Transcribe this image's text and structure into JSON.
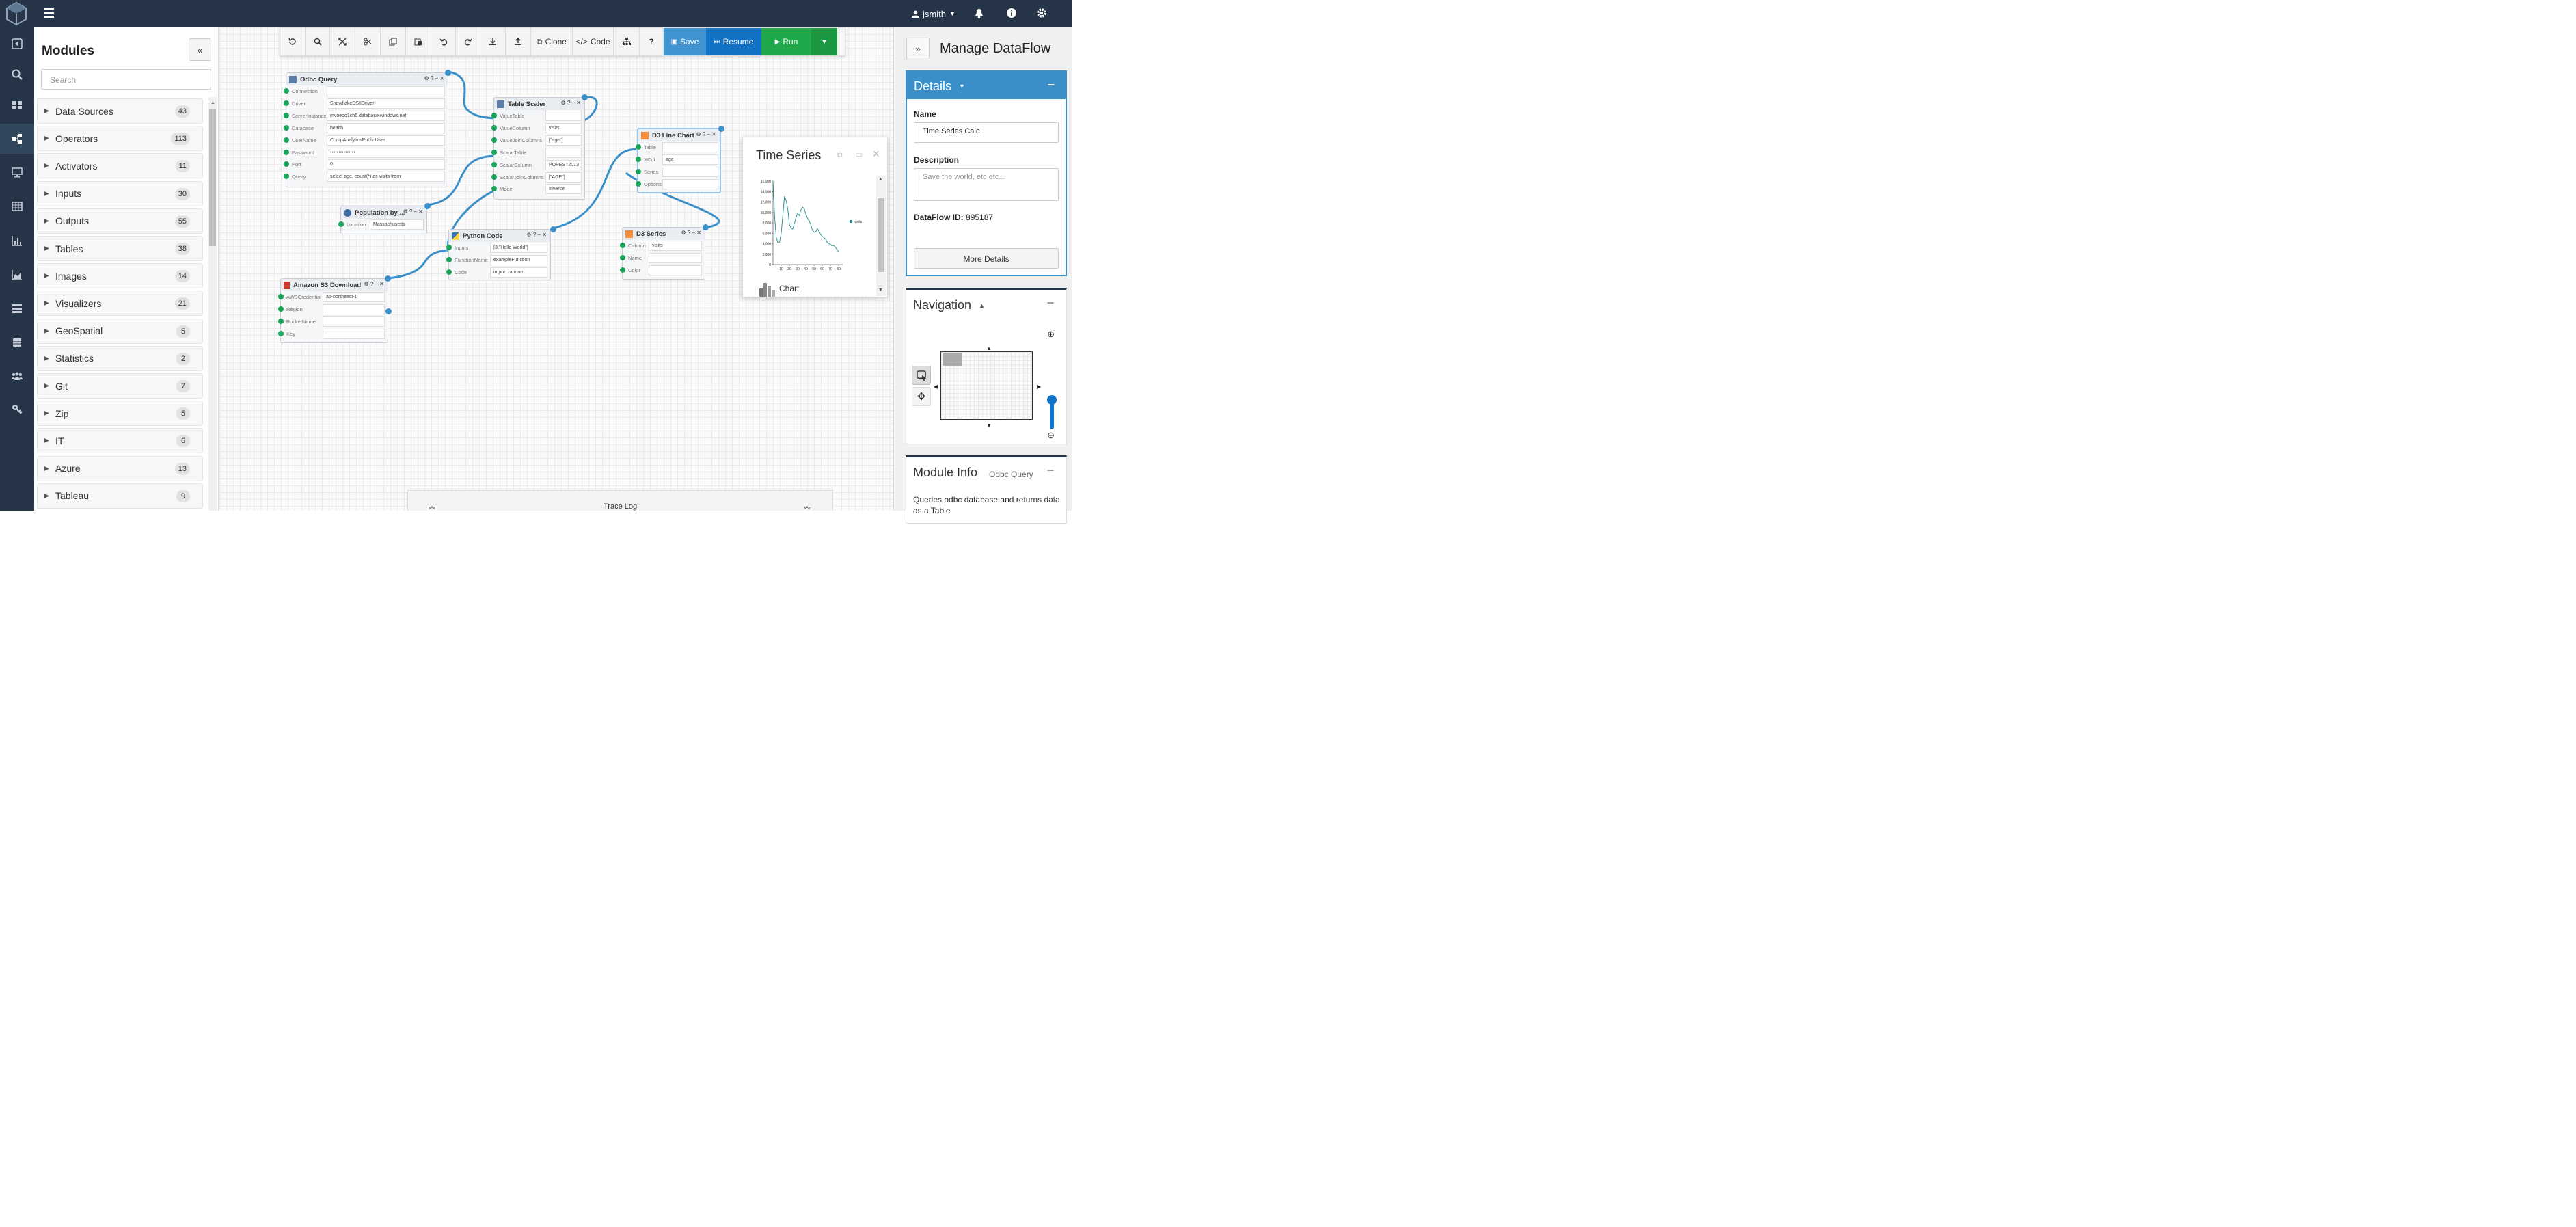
{
  "topbar": {
    "user": "jsmith"
  },
  "modules": {
    "title": "Modules",
    "search_placeholder": "Search",
    "items": [
      {
        "label": "Data Sources",
        "count": "43"
      },
      {
        "label": "Operators",
        "count": "113"
      },
      {
        "label": "Activators",
        "count": "11"
      },
      {
        "label": "Inputs",
        "count": "30"
      },
      {
        "label": "Outputs",
        "count": "55"
      },
      {
        "label": "Tables",
        "count": "38"
      },
      {
        "label": "Images",
        "count": "14"
      },
      {
        "label": "Visualizers",
        "count": "21"
      },
      {
        "label": "GeoSpatial",
        "count": "5"
      },
      {
        "label": "Statistics",
        "count": "2"
      },
      {
        "label": "Git",
        "count": "7"
      },
      {
        "label": "Zip",
        "count": "5"
      },
      {
        "label": "IT",
        "count": "6"
      },
      {
        "label": "Azure",
        "count": "13"
      },
      {
        "label": "Tableau",
        "count": "9"
      }
    ]
  },
  "toolbar": {
    "clone": "Clone",
    "code": "Code",
    "help": "?",
    "save": "Save",
    "resume": "Resume",
    "run": "Run"
  },
  "nodes": {
    "odbc": {
      "title": "Odbc Query",
      "params": [
        {
          "label": "Connection",
          "value": ""
        },
        {
          "label": "Driver",
          "value": "SnowflakeDSIIDriver"
        },
        {
          "label": "ServerInstance",
          "value": "mvoeqq1ch5.database.windows.net"
        },
        {
          "label": "Database",
          "value": "health"
        },
        {
          "label": "UserName",
          "value": "CompAnalyticsPublicUser"
        },
        {
          "label": "Password",
          "value": "•••••••••••••••"
        },
        {
          "label": "Port",
          "value": "0"
        },
        {
          "label": "Query",
          "value": "select age, count(*) as visits from"
        }
      ]
    },
    "scaler": {
      "title": "Table Scaler",
      "params": [
        {
          "label": "ValueTable",
          "value": ""
        },
        {
          "label": "ValueColumn",
          "value": "visits"
        },
        {
          "label": "ValueJoinColumns",
          "value": "[\"age\"]"
        },
        {
          "label": "ScalarTable",
          "value": ""
        },
        {
          "label": "ScalarColumn",
          "value": "POPEST2013_"
        },
        {
          "label": "ScalarJoinColumns",
          "value": "[\"AGE\"]"
        },
        {
          "label": "Mode",
          "value": "Inverse"
        }
      ]
    },
    "population": {
      "title": "Population by ...",
      "params": [
        {
          "label": "Location",
          "value": "Massachusetts"
        }
      ]
    },
    "python": {
      "title": "Python Code",
      "params": [
        {
          "label": "Inputs",
          "value": "[3,\"Hello World\"]"
        },
        {
          "label": "FunctionName",
          "value": "exampleFunction"
        },
        {
          "label": "Code",
          "value": "import random"
        }
      ]
    },
    "s3": {
      "title": "Amazon S3 Download",
      "params": [
        {
          "label": "AWSCredential",
          "value": "ap-northeast-1"
        },
        {
          "label": "Region",
          "value": ""
        },
        {
          "label": "BucketName",
          "value": ""
        },
        {
          "label": "Key",
          "value": ""
        }
      ]
    },
    "d3line": {
      "title": "D3 Line Chart",
      "params": [
        {
          "label": "Table",
          "value": ""
        },
        {
          "label": "XCol",
          "value": "age"
        },
        {
          "label": "Series",
          "value": ""
        },
        {
          "label": "Options",
          "value": ""
        }
      ]
    },
    "d3series": {
      "title": "D3 Series",
      "params": [
        {
          "label": "Column",
          "value": "visits"
        },
        {
          "label": "Name",
          "value": ""
        },
        {
          "label": "Color",
          "value": ""
        }
      ]
    }
  },
  "timeseries": {
    "title": "Time Series",
    "chart_label": "Chart",
    "chart_data": {
      "type": "line",
      "series": [
        {
          "name": "visits",
          "x": [
            0,
            2,
            4,
            6,
            8,
            10,
            12,
            14,
            16,
            18,
            20,
            22,
            24,
            26,
            28,
            30,
            32,
            34,
            36,
            38,
            40,
            42,
            44,
            46,
            48,
            50,
            52,
            54,
            56,
            58,
            60,
            62,
            64,
            66,
            68,
            70,
            72,
            74,
            76,
            78,
            80
          ],
          "y": [
            16000,
            9000,
            5200,
            4200,
            4300,
            6000,
            9500,
            13100,
            12300,
            10600,
            7700,
            7000,
            6800,
            7800,
            9000,
            9800,
            9400,
            10500,
            11000,
            10700,
            9700,
            8900,
            8400,
            7700,
            6600,
            6200,
            6200,
            6900,
            6400,
            5800,
            5400,
            5200,
            4900,
            4300,
            4000,
            3900,
            3600,
            3700,
            3300,
            2900,
            2500
          ]
        }
      ],
      "xticks": [
        "10",
        "20",
        "30",
        "40",
        "50",
        "60",
        "70",
        "80"
      ],
      "yticks": [
        "0",
        "2,000",
        "4,000",
        "6,000",
        "8,000",
        "10,000",
        "12,000",
        "14,000",
        "16,000"
      ],
      "xlim": [
        0,
        85
      ],
      "ylim": [
        0,
        16000
      ],
      "legend": "right",
      "color": "#1b8a8a"
    }
  },
  "tracelog": {
    "label": "Trace Log"
  },
  "right": {
    "title": "Manage DataFlow",
    "details": {
      "heading": "Details",
      "name_label": "Name",
      "name_value": "Time Series Calc",
      "desc_label": "Description",
      "desc_placeholder": "Save the world, etc etc...",
      "id_label": "DataFlow ID:",
      "id_value": "895187",
      "more_button": "More Details"
    },
    "navigation": {
      "heading": "Navigation"
    },
    "module_info": {
      "heading": "Module Info",
      "sub": "Odbc Query",
      "desc": "Queries odbc database and returns data as a Table"
    }
  },
  "colors": {
    "dark_nav": "#253547",
    "accent": "#3a8fc9",
    "run_green": "#1fa94a",
    "save_blue": "#4294d0",
    "resume_blue": "#1172c6",
    "port_green": "#18a558"
  }
}
